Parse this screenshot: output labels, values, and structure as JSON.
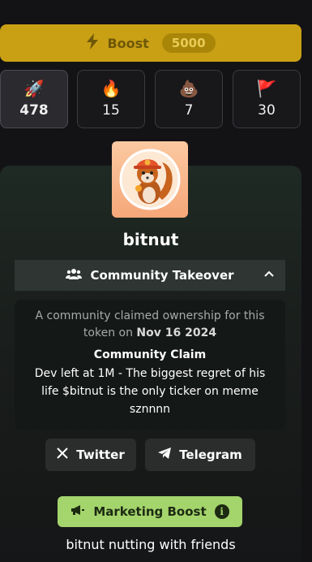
{
  "boost": {
    "label": "Boost",
    "count": "5000",
    "icon": "lightning-icon"
  },
  "reactions": [
    {
      "emoji": "🚀",
      "icon": "rocket-icon",
      "count": "478",
      "active": true
    },
    {
      "emoji": "🔥",
      "icon": "fire-icon",
      "count": "15",
      "active": false
    },
    {
      "emoji": "💩",
      "icon": "poop-icon",
      "count": "7",
      "active": false
    },
    {
      "emoji": "🚩",
      "icon": "red-flag-icon",
      "count": "30",
      "active": false
    }
  ],
  "token": {
    "name": "bitnut"
  },
  "takeover": {
    "label": "Community Takeover",
    "icon": "users-icon",
    "expanded": true
  },
  "claim": {
    "desc_prefix": "A community claimed ownership for this token on ",
    "date": "Nov 16 2024",
    "title": "Community Claim",
    "text": "Dev left at 1M - The biggest regret of his life $bitnut is the only ticker on meme sznnnn"
  },
  "links": {
    "twitter": {
      "label": "Twitter",
      "icon": "x-icon"
    },
    "telegram": {
      "label": "Telegram",
      "icon": "telegram-icon"
    }
  },
  "marketing": {
    "label": "Marketing Boost",
    "icon": "megaphone-icon",
    "info_icon": "info-icon"
  },
  "tagline": "bitnut nutting with friends",
  "colors": {
    "boost": "#c9a014",
    "marketing": "#a4d46c",
    "background": "#131316"
  }
}
